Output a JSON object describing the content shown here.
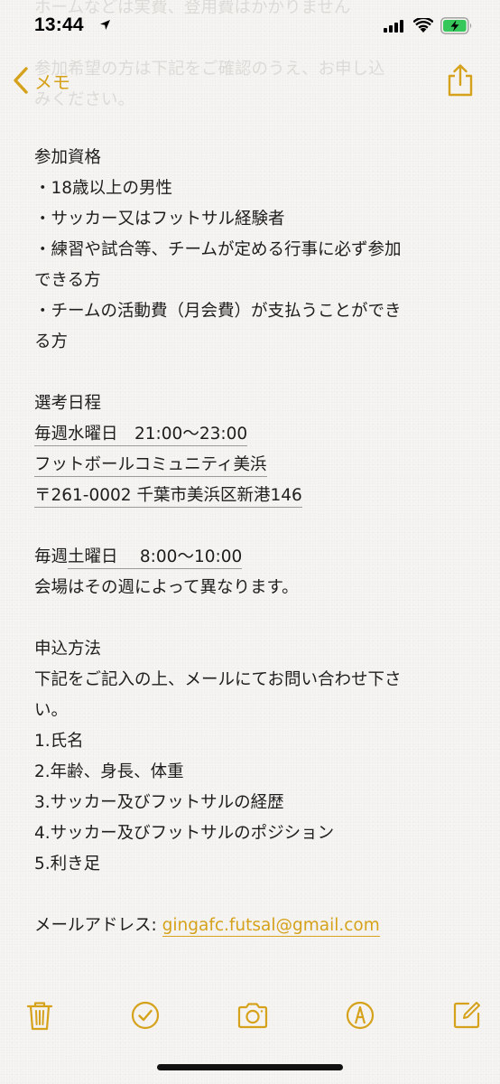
{
  "status_bar": {
    "time": "13:44"
  },
  "ghost_text": {
    "line1": "ホームなどは実費、登用費はかかりません",
    "line2": "参加希望の方は下記をご確認のうえ、お申し込",
    "line3": "みください。"
  },
  "nav": {
    "back_label": "メモ"
  },
  "note": {
    "lines": {
      "l01": "参加資格",
      "l02": "・18歳以上の男性",
      "l03": "・サッカー又はフットサル経験者",
      "l04": "・練習や試合等、チームが定める行事に必ず参加",
      "l05": "できる方",
      "l06": "・チームの活動費（月会費）が支払うことができ",
      "l07": "る方",
      "l08": "選考日程",
      "l09": "毎週水曜日　21:00〜23:00",
      "l10": "フットボールコミュニティ美浜",
      "l11": "〒261-0002 千葉市美浜区新港146",
      "l12_a": "毎週",
      "l12_b": "土曜日　  8:00〜10:00",
      "l13": "会場はその週によって異なります。",
      "l14": "申込方法",
      "l15": "下記をご記入の上、メールにてお問い合わせ下さ",
      "l16": "い。",
      "l17": "1.氏名",
      "l18": "2.年齢、身長、体重",
      "l19": "3.サッカー及びフットサルの経歴",
      "l20": "4.サッカー及びフットサルのポジション",
      "l21": "5.利き足",
      "l22_label": "メールアドレス: ",
      "l22_email": "gingafc.futsal@gmail.com"
    }
  },
  "colors": {
    "accent": "#d6a21c",
    "background": "#f6f5f2",
    "text": "#1e1e1e"
  },
  "icons": {
    "location": "location-arrow-icon",
    "signal": "cellular-signal-icon",
    "wifi": "wifi-icon",
    "battery": "battery-charging-icon",
    "back": "chevron-left-icon",
    "share": "share-icon",
    "trash": "trash-icon",
    "checklist": "checklist-icon",
    "camera": "camera-icon",
    "markup": "markup-pen-icon",
    "compose": "compose-icon"
  }
}
